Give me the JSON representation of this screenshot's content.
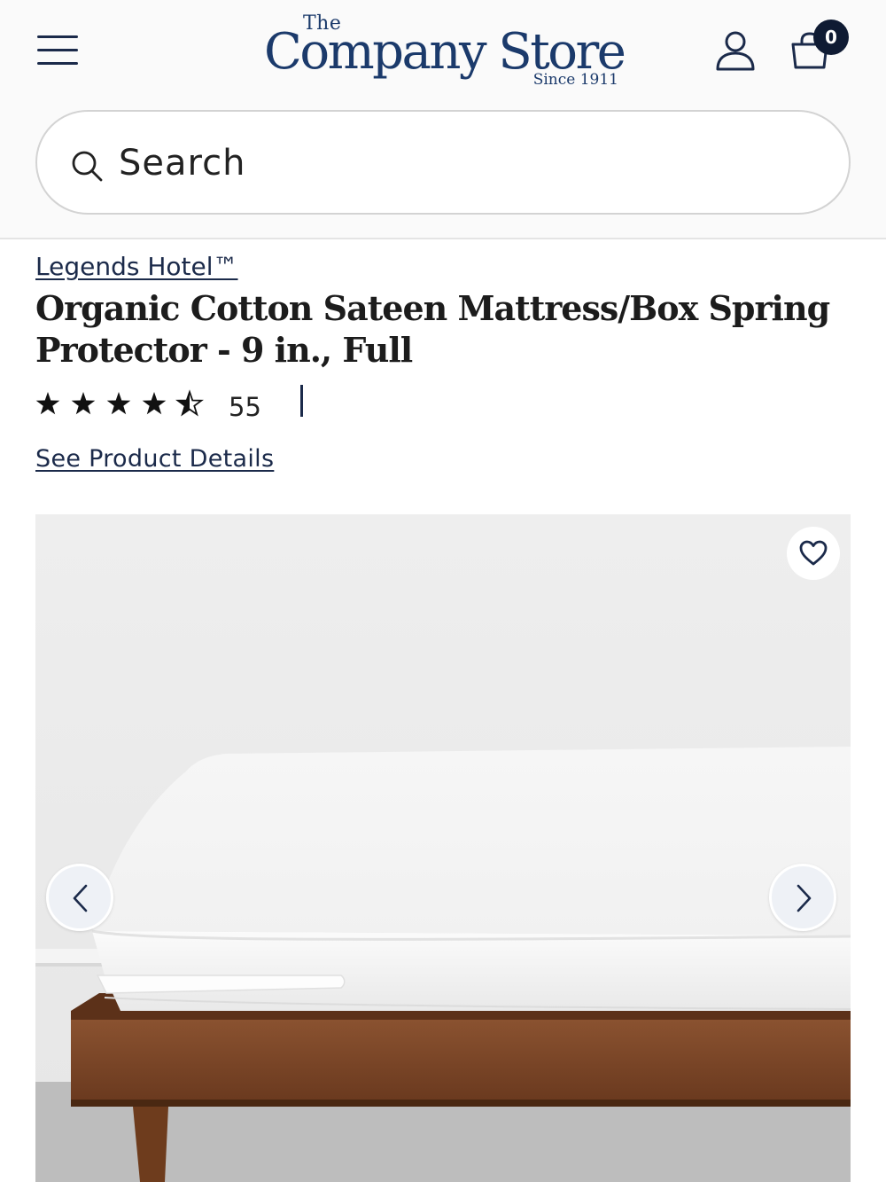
{
  "header": {
    "logo_the": "The",
    "logo_name": "Company Store",
    "logo_since": "Since 1911",
    "cart_count": "0",
    "menu_icon": "hamburger-menu-icon",
    "account_icon": "user-icon",
    "cart_icon": "shopping-bag-icon"
  },
  "search": {
    "placeholder": "Search",
    "value": ""
  },
  "product": {
    "brand": "Legends Hotel™",
    "title": "Organic Cotton Sateen Mattress/Box Spring Protector - 9 in., Full",
    "rating": 4.5,
    "rating_max": 5,
    "review_count": "55",
    "details_link": "See Product Details"
  },
  "gallery": {
    "wishlist_icon": "heart-icon",
    "prev_icon": "chevron-left-icon",
    "next_icon": "chevron-right-icon"
  },
  "colors": {
    "brand_navy": "#1b3a6b",
    "text_dark": "#1c1c1c",
    "badge_bg": "#0f1b33",
    "wood": "#7a4526"
  }
}
